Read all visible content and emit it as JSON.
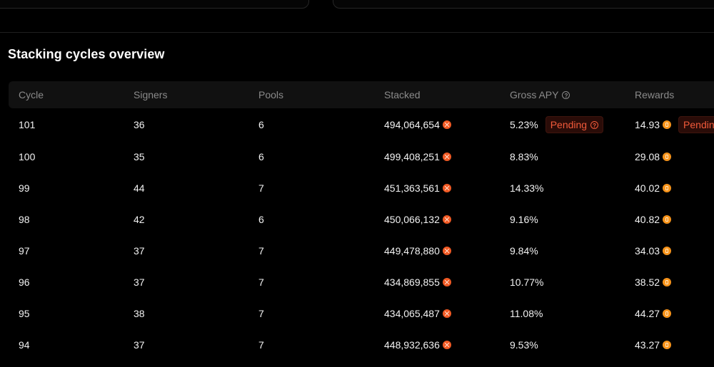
{
  "section": {
    "title": "Stacking cycles overview"
  },
  "table": {
    "headers": {
      "cycle": "Cycle",
      "signers": "Signers",
      "pools": "Pools",
      "stacked": "Stacked",
      "gross_apy": "Gross APY",
      "rewards": "Rewards"
    },
    "pending_label": "Pending",
    "rows": [
      {
        "cycle": "101",
        "signers": "36",
        "pools": "6",
        "stacked": "494,064,654",
        "gross_apy": "5.23%",
        "rewards": "14.93",
        "pending": true
      },
      {
        "cycle": "100",
        "signers": "35",
        "pools": "6",
        "stacked": "499,408,251",
        "gross_apy": "8.83%",
        "rewards": "29.08",
        "pending": false
      },
      {
        "cycle": "99",
        "signers": "44",
        "pools": "7",
        "stacked": "451,363,561",
        "gross_apy": "14.33%",
        "rewards": "40.02",
        "pending": false
      },
      {
        "cycle": "98",
        "signers": "42",
        "pools": "6",
        "stacked": "450,066,132",
        "gross_apy": "9.16%",
        "rewards": "40.82",
        "pending": false
      },
      {
        "cycle": "97",
        "signers": "37",
        "pools": "7",
        "stacked": "449,478,880",
        "gross_apy": "9.84%",
        "rewards": "34.03",
        "pending": false
      },
      {
        "cycle": "96",
        "signers": "37",
        "pools": "7",
        "stacked": "434,869,855",
        "gross_apy": "10.77%",
        "rewards": "38.52",
        "pending": false
      },
      {
        "cycle": "95",
        "signers": "38",
        "pools": "7",
        "stacked": "434,065,487",
        "gross_apy": "11.08%",
        "rewards": "44.27",
        "pending": false
      },
      {
        "cycle": "94",
        "signers": "37",
        "pools": "7",
        "stacked": "448,932,636",
        "gross_apy": "9.53%",
        "rewards": "43.27",
        "pending": false
      }
    ]
  },
  "icons": {
    "stacked_token": "stx-icon",
    "rewards_token": "btc-icon",
    "help": "help-icon"
  },
  "colors": {
    "background": "#000000",
    "header_bg": "#111111",
    "stx_orange": "#f25a24",
    "btc_orange": "#f7931a",
    "pending_text": "#f25a3a",
    "pending_bg": "#2a0c08"
  }
}
